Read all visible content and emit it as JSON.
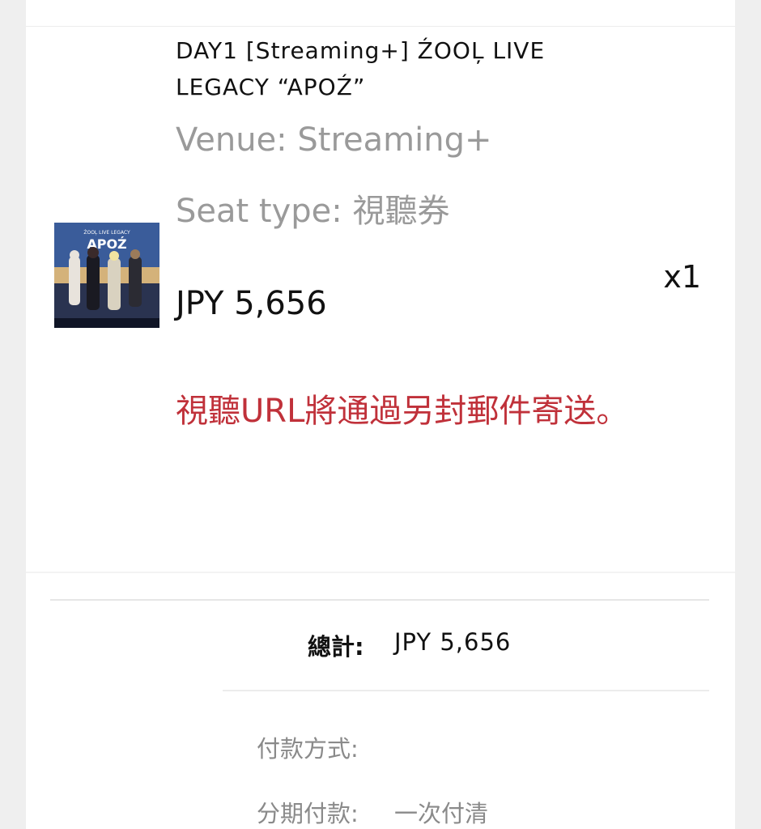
{
  "item": {
    "title": "DAY1 [Streaming+] ŹOOĻ LIVE LEGACY “APOŹ”",
    "venue": "Venue: Streaming+",
    "seat_type": "Seat type: 視聽券",
    "price": "JPY 5,656",
    "quantity": "x1",
    "notice": "視聽URL將通過另封郵件寄送。",
    "image": {
      "alt": "ŹOOĻ LIVE LEGACY APOŹ key visual",
      "top_text": "ŹOOĻ LIVE LEGACY",
      "logo_text": "APOŹ"
    }
  },
  "summary": {
    "total_label": "總計:",
    "total_value": "JPY 5,656",
    "payment_method_label": "付款方式:",
    "payment_method_value": "",
    "installments_label": "分期付款:",
    "installments_value": "一次付清"
  },
  "colors": {
    "notice": "#c0313a",
    "muted": "#9a9a9a",
    "background": "#efefef"
  }
}
